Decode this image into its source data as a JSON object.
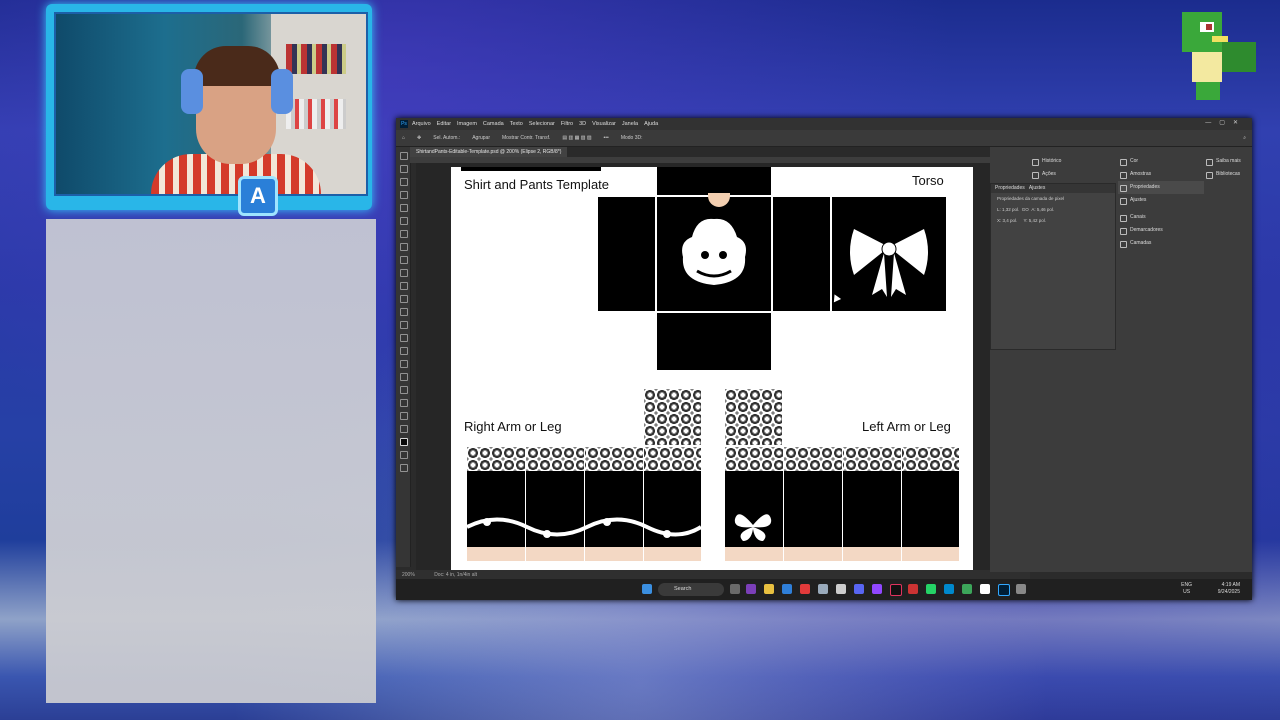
{
  "photoshop": {
    "menu": [
      "Arquivo",
      "Editar",
      "Imagem",
      "Camada",
      "Texto",
      "Selecionar",
      "Filtro",
      "3D",
      "Visualizar",
      "Janela",
      "Ajuda"
    ],
    "options": {
      "auto_select": "Sel. Autom.:",
      "group": "Agrupar",
      "transform_controls": "Mostrar Contr. Transf.",
      "mode3d": "Modo 3D:"
    },
    "document_tab": "ShirtandPants-Editable-Template.psd @ 200% (Elipse 2, RGB/8*)",
    "canvas": {
      "title": "Shirt and Pants Template",
      "torso_label": "Torso",
      "right_label": "Right Arm or Leg",
      "left_label": "Left Arm or Leg"
    },
    "status": {
      "zoom": "200%",
      "doc_size": "Doc: 4 in, 1n/4in alt"
    },
    "panels": {
      "col1": [
        "Histórico",
        "Ações"
      ],
      "col2": [
        "Cor",
        "Amostras",
        "Propriedades",
        "Ajustes",
        "Canais",
        "Demarcadores",
        "Camadas"
      ],
      "col3": [
        "Saiba mais",
        "Bibliotecas"
      ],
      "properties_tabs": [
        "Propriedades",
        "Ajustes"
      ],
      "properties_title": "Propriedades da camada de pixel",
      "fields": {
        "L": "1,32 pol.",
        "A": "5,46 pol.",
        "X": "3,4 pol.",
        "Y": "5,42 pol.",
        "link": "GO"
      }
    }
  },
  "taskbar": {
    "search": "Search",
    "lang": "ENG",
    "region": "US",
    "time": "4:19 AM",
    "date": "9/24/2025"
  },
  "colors": {
    "accent": "#31a8ff",
    "cam_border": "#29b6e8"
  }
}
